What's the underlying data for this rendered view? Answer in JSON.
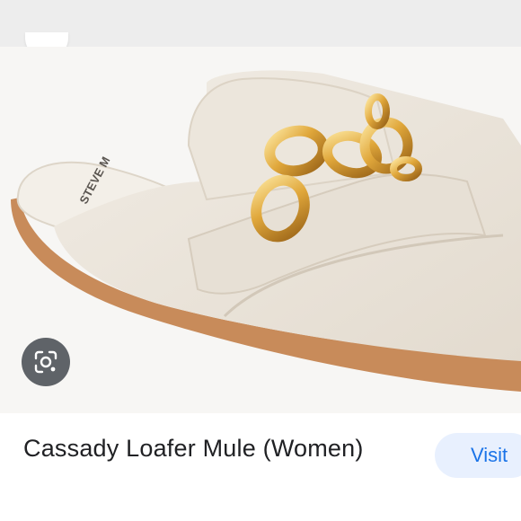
{
  "product": {
    "title": "Cassady Loafer Mule (Women)",
    "image_brand_mark": "STEVE M",
    "image_alt": "Cream leather loafer mule with gold chain detail"
  },
  "actions": {
    "visit_label": "Visit",
    "lens_icon": "lens-search-icon"
  },
  "colors": {
    "accent": "#1a73e8",
    "visit_bg": "#e8f0fe",
    "lens_bg": "#5f6368",
    "leather": "#ebe5dc",
    "sole": "#c88b5a",
    "gold": "#e0a73b"
  }
}
